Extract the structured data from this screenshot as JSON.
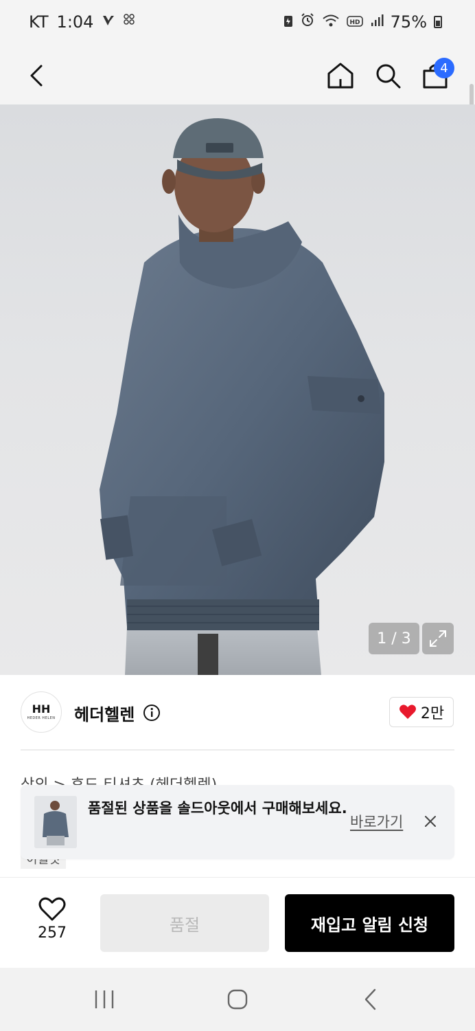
{
  "status_bar": {
    "carrier": "KT",
    "time": "1:04",
    "battery": "75%",
    "icons": [
      "v-notification-icon",
      "grid-notification-icon",
      "battery-saver-icon",
      "alarm-icon",
      "wifi-icon",
      "hd-icon",
      "signal-icon",
      "battery-icon"
    ]
  },
  "nav": {
    "cart_count": "4",
    "icons": [
      "back-icon",
      "home-icon",
      "search-icon",
      "cart-icon"
    ]
  },
  "gallery": {
    "counter": "1 / 3"
  },
  "brand": {
    "logo_mark": "HH",
    "logo_sub": "HEDER HELEN",
    "name": "헤더헬렌",
    "likes": "2만",
    "heart_color": "#e8192c"
  },
  "breadcrumb": "상의 > 후드 티셔츠 (헤더헬렌)",
  "tag": "이월핏",
  "toast": {
    "message": "품절된 상품을 솔드아웃에서 구매해보세요.",
    "link_label": "바로가기"
  },
  "actions": {
    "wish_count": "257",
    "soldout_label": "품절",
    "restock_label": "재입고 알림 신청"
  },
  "colors": {
    "accent_badge": "#2b6bff",
    "primary_button": "#000000",
    "disabled_button": "#ebebeb"
  }
}
